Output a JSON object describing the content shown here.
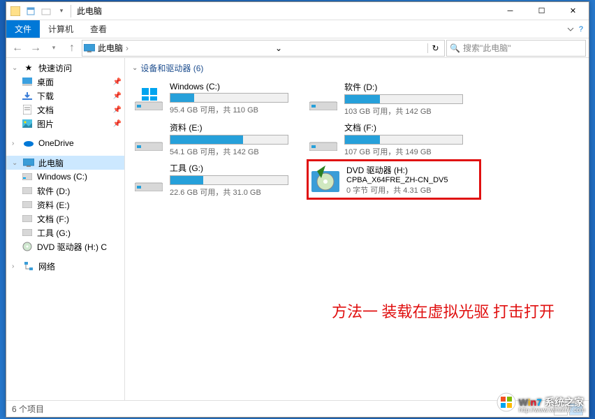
{
  "window": {
    "title": "此电脑"
  },
  "ribbon": {
    "file": "文件",
    "computer": "计算机",
    "view": "查看"
  },
  "breadcrumb": {
    "root": "此电脑"
  },
  "search": {
    "placeholder": "搜索\"此电脑\""
  },
  "sidebar": {
    "quick": {
      "label": "快速访问",
      "items": [
        {
          "label": "桌面",
          "icon": "desktop"
        },
        {
          "label": "下载",
          "icon": "downloads"
        },
        {
          "label": "文档",
          "icon": "documents"
        },
        {
          "label": "图片",
          "icon": "pictures"
        }
      ]
    },
    "onedrive": {
      "label": "OneDrive"
    },
    "thispc": {
      "label": "此电脑",
      "items": [
        {
          "label": "Windows (C:)"
        },
        {
          "label": "软件 (D:)"
        },
        {
          "label": "资料 (E:)"
        },
        {
          "label": "文档 (F:)"
        },
        {
          "label": "工具 (G:)"
        },
        {
          "label": "DVD 驱动器 (H:) C"
        }
      ]
    },
    "network": {
      "label": "网络"
    }
  },
  "section": {
    "title": "设备和驱动器 (6)"
  },
  "drives": [
    {
      "name": "Windows (C:)",
      "bar": 20,
      "stat": "95.4 GB 可用，共 110 GB",
      "type": "os"
    },
    {
      "name": "软件 (D:)",
      "bar": 30,
      "stat": "103 GB 可用，共 142 GB",
      "type": "hdd"
    },
    {
      "name": "资料 (E:)",
      "bar": 62,
      "stat": "54.1 GB 可用，共 142 GB",
      "type": "hdd"
    },
    {
      "name": "文档 (F:)",
      "bar": 30,
      "stat": "107 GB 可用，共 149 GB",
      "type": "hdd"
    },
    {
      "name": "工具 (G:)",
      "bar": 28,
      "stat": "22.6 GB 可用，共 31.0 GB",
      "type": "hdd"
    },
    {
      "name": "DVD 驱动器 (H:)",
      "sub": "CPBA_X64FRE_ZH-CN_DV5",
      "stat": "0 字节 可用，共 4.31 GB",
      "type": "dvd",
      "highlight": true
    }
  ],
  "annotation": "方法一 装载在虚拟光驱 打击打开",
  "status": {
    "text": "6 个项目"
  },
  "watermark": {
    "brand": "Win7",
    "text": "系统之家",
    "url": "http://www.winwin7.com"
  }
}
